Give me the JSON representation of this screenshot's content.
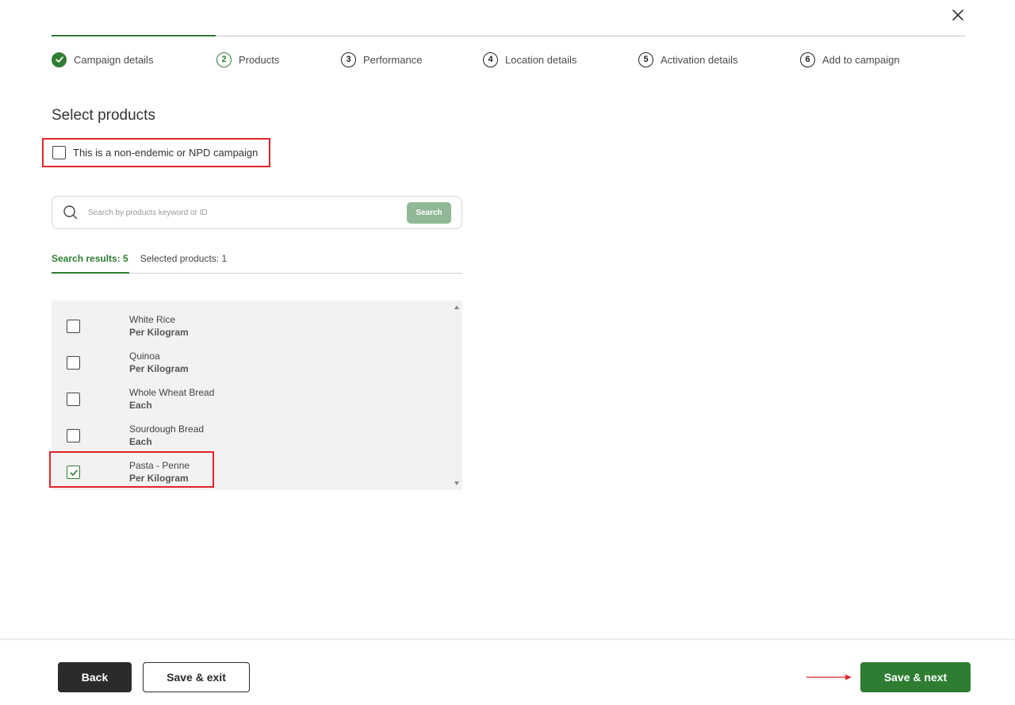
{
  "stepper": {
    "progress_fraction": 0.18,
    "steps": [
      {
        "number": "",
        "label": "Campaign details",
        "state": "done"
      },
      {
        "number": "2",
        "label": "Products",
        "state": "active"
      },
      {
        "number": "3",
        "label": "Performance",
        "state": "pending"
      },
      {
        "number": "4",
        "label": "Location details",
        "state": "pending"
      },
      {
        "number": "5",
        "label": "Activation details",
        "state": "pending"
      },
      {
        "number": "6",
        "label": "Add to campaign",
        "state": "pending"
      }
    ]
  },
  "section_title": "Select products",
  "npd": {
    "label": "This is a non-endemic or NPD campaign",
    "checked": false
  },
  "search": {
    "placeholder": "Search by products keyword or ID",
    "button_label": "Search"
  },
  "tabs": [
    {
      "label": "Search results: 5",
      "active": true
    },
    {
      "label": "Selected products: 1",
      "active": false
    }
  ],
  "products": [
    {
      "name": "White Rice",
      "unit": "Per Kilogram",
      "checked": false
    },
    {
      "name": "Quinoa",
      "unit": "Per Kilogram",
      "checked": false
    },
    {
      "name": "Whole Wheat Bread",
      "unit": "Each",
      "checked": false
    },
    {
      "name": "Sourdough Bread",
      "unit": "Each",
      "checked": false
    },
    {
      "name": "Pasta - Penne",
      "unit": "Per Kilogram",
      "checked": true
    }
  ],
  "footer": {
    "back_label": "Back",
    "save_exit_label": "Save & exit",
    "save_next_label": "Save & next"
  },
  "colors": {
    "accent": "#2e7d32",
    "highlight": "#e0242a",
    "search_button": "#90b896",
    "dark_button": "#2b2b2b"
  },
  "icons": {
    "close": "close-icon",
    "search": "search-icon",
    "check": "check-icon",
    "arrow": "arrow-right-icon"
  }
}
